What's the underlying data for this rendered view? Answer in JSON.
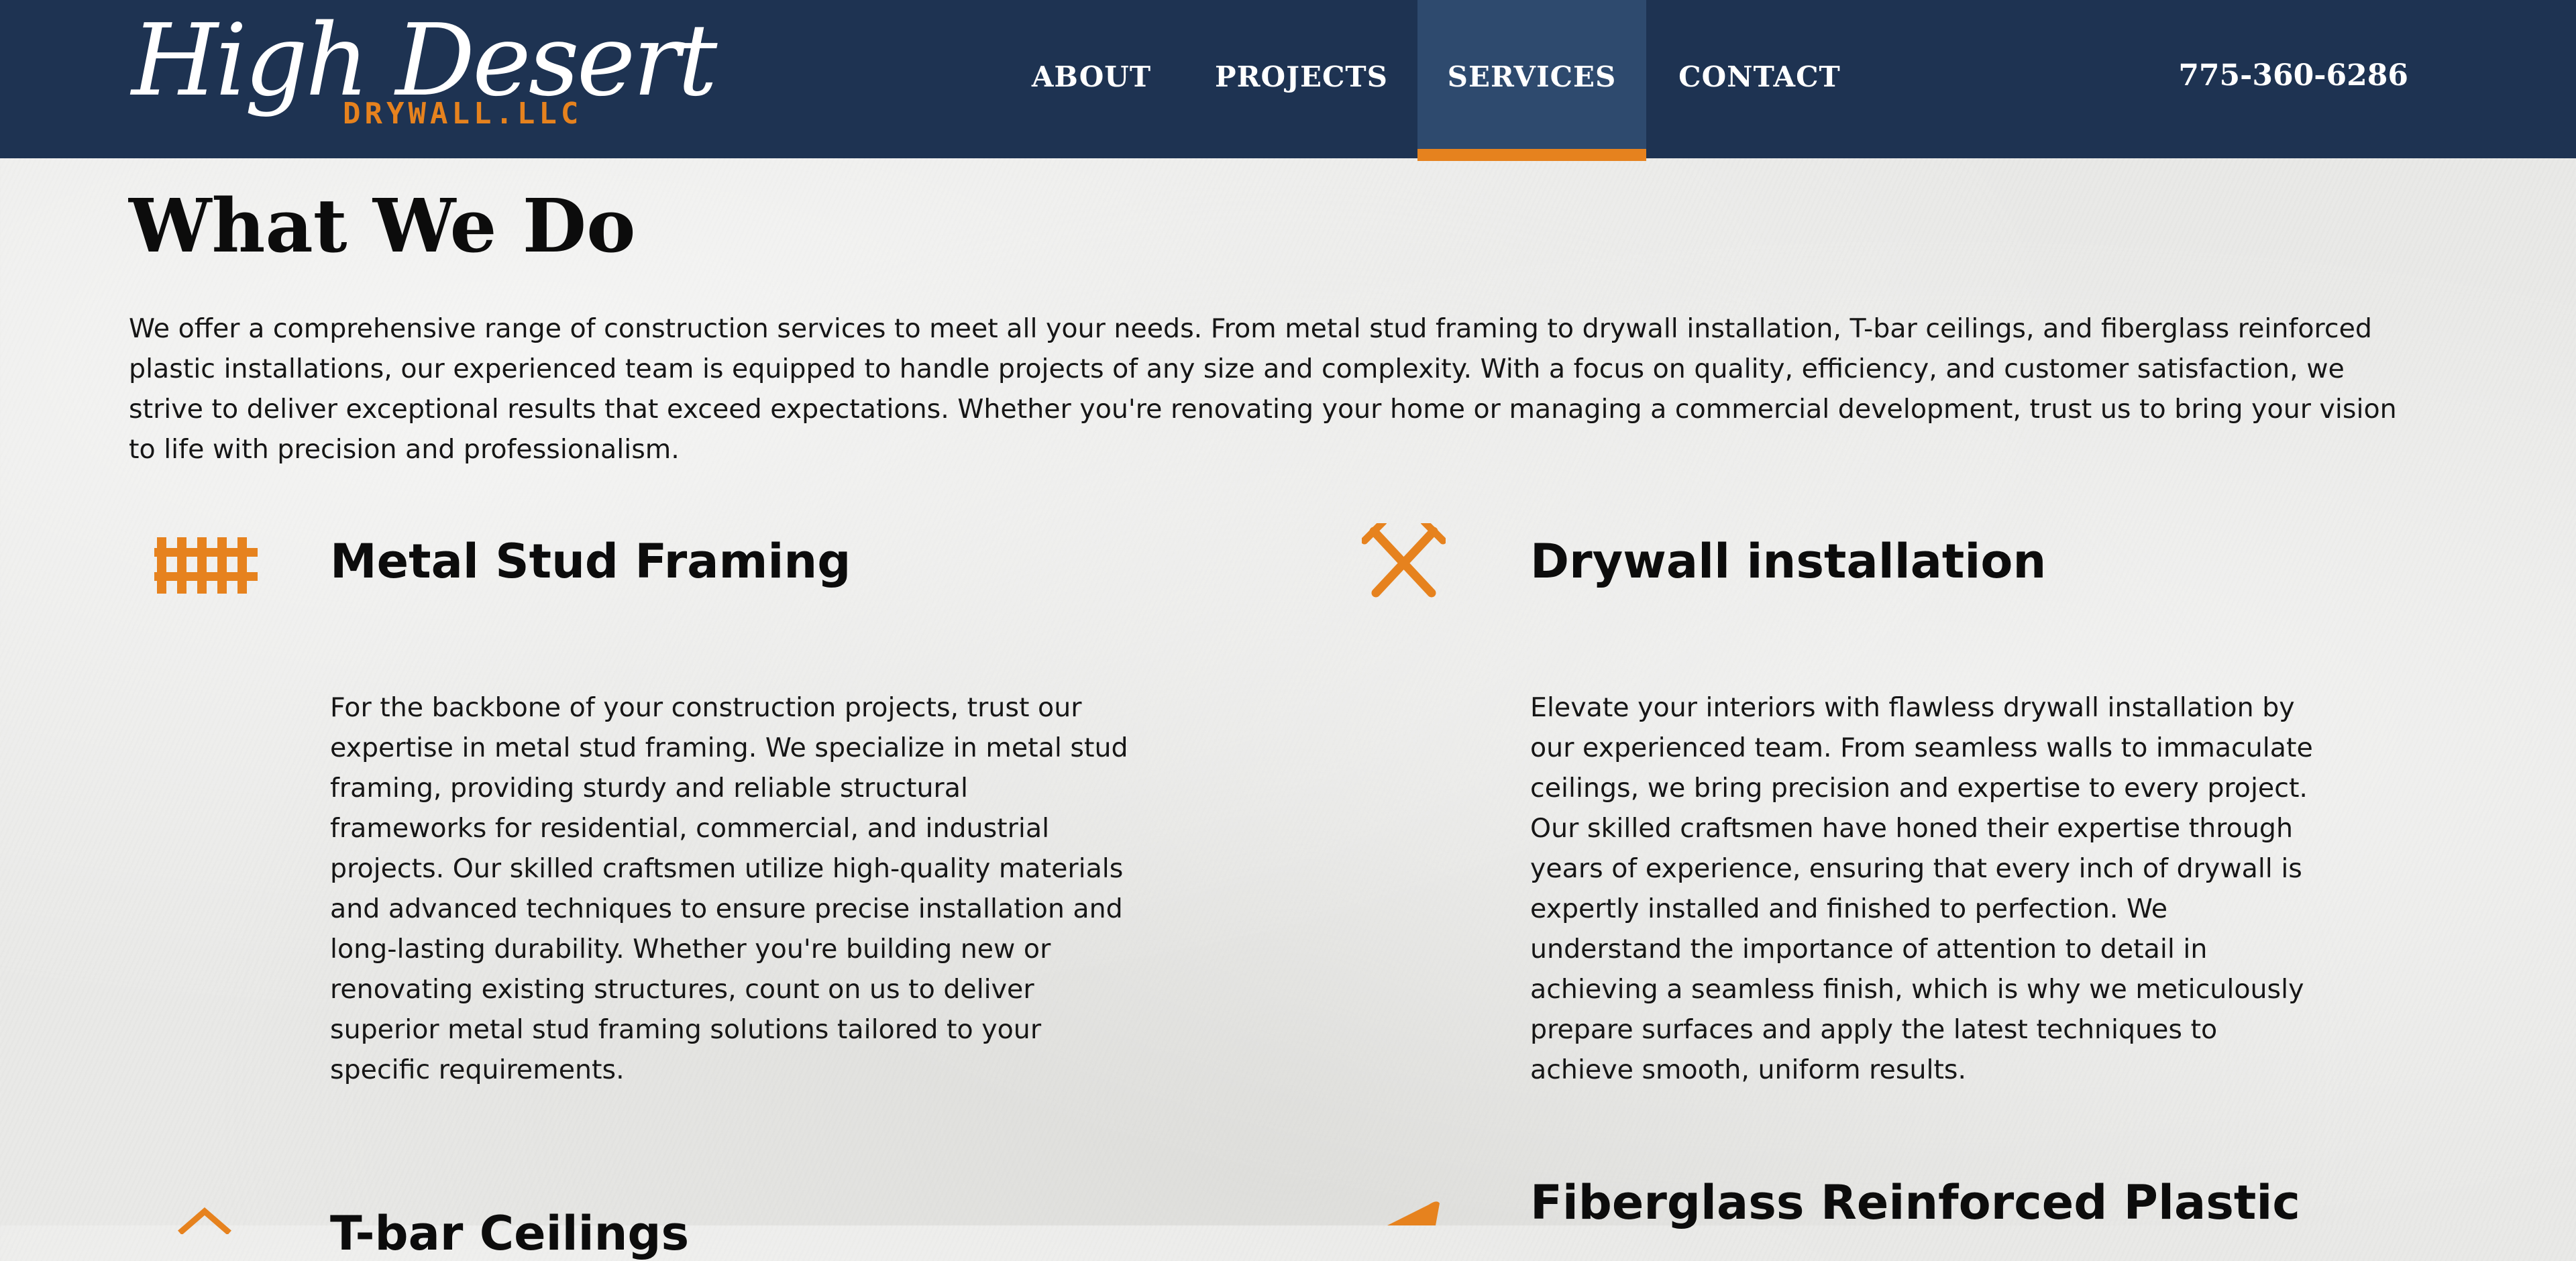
{
  "brand": {
    "logo_script": "High Desert",
    "logo_subtitle": "DRYWALL.LLC",
    "accent_color": "#e6821e",
    "header_color": "#1e3352"
  },
  "nav": {
    "items": [
      {
        "label": "ABOUT"
      },
      {
        "label": "PROJECTS"
      },
      {
        "label": "SERVICES",
        "active": true
      },
      {
        "label": "CONTACT"
      }
    ]
  },
  "header": {
    "phone": "775-360-6286"
  },
  "main": {
    "title": "What We Do",
    "intro": "We offer a comprehensive range of construction services to meet all your needs. From metal stud framing to drywall installation, T-bar ceilings, and fiberglass reinforced plastic installations, our experienced team is equipped to handle projects of any size and complexity. With a focus on quality, efficiency, and customer satisfaction, we strive to deliver exceptional results that exceed expectations. Whether you're renovating your home or managing a commercial development, trust us to bring your vision to life with precision and professionalism.",
    "services": [
      {
        "icon": "fence-icon",
        "title": "Metal Stud Framing",
        "description": "For the backbone of your construction projects, trust our expertise in metal stud framing. We specialize in metal stud framing, providing sturdy and reliable structural frameworks for residential, commercial, and industrial projects. Our skilled craftsmen utilize high-quality materials and advanced techniques to ensure precise installation and long-lasting durability. Whether you're building new or renovating existing structures, count on us to deliver superior metal stud framing solutions tailored to your specific requirements."
      },
      {
        "icon": "crossed-screws-icon",
        "title": "Drywall installation",
        "description": "Elevate your interiors with flawless drywall installation by our experienced team. From seamless walls to immaculate ceilings, we bring precision and expertise to every project. Our skilled craftsmen have honed their expertise through years of experience, ensuring that every inch of drywall is expertly installed and finished to perfection. We understand the importance of attention to detail in achieving a seamless finish, which is why we meticulously prepare surfaces and apply the latest techniques to achieve smooth, uniform results."
      },
      {
        "icon": "house-icon",
        "title": "T-bar Ceilings",
        "description": ""
      },
      {
        "icon": "trowel-icon",
        "title": "Fiberglass Reinforced Plastic",
        "description": ""
      }
    ]
  }
}
